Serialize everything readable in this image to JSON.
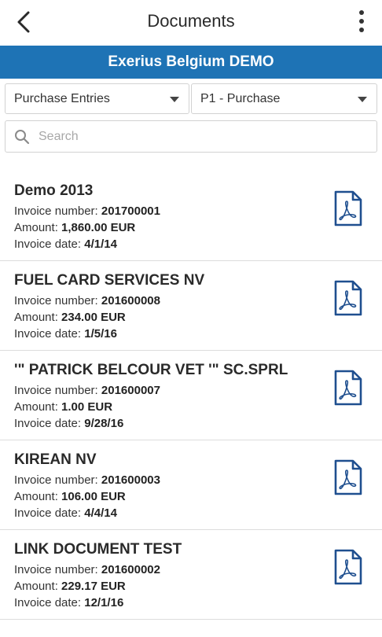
{
  "header": {
    "title": "Documents",
    "back_icon": "chevron-left-icon",
    "menu_icon": "more-vertical-icon"
  },
  "company": {
    "name": "Exerius Belgium DEMO",
    "color": "#1e73b5"
  },
  "filters": {
    "journal_type": "Purchase Entries",
    "journal": "P1 - Purchase"
  },
  "search": {
    "placeholder": "Search",
    "value": ""
  },
  "labels": {
    "invoice_number": "Invoice number: ",
    "amount": "Amount: ",
    "invoice_date": "Invoice date: "
  },
  "documents": [
    {
      "title": "Demo 2013",
      "invoice_number": "201700001",
      "amount": "1,860.00 EUR",
      "invoice_date": "4/1/14",
      "icon": "pdf-icon"
    },
    {
      "title": "FUEL CARD SERVICES NV",
      "invoice_number": "201600008",
      "amount": "234.00 EUR",
      "invoice_date": "1/5/16",
      "icon": "pdf-icon"
    },
    {
      "title": "'\" PATRICK BELCOUR VET '\" SC.SPRL",
      "invoice_number": "201600007",
      "amount": "1.00 EUR",
      "invoice_date": "9/28/16",
      "icon": "pdf-icon"
    },
    {
      "title": "KIREAN NV",
      "invoice_number": "201600003",
      "amount": "106.00 EUR",
      "invoice_date": "4/4/14",
      "icon": "pdf-icon"
    },
    {
      "title": "LINK DOCUMENT TEST",
      "invoice_number": "201600002",
      "amount": "229.17 EUR",
      "invoice_date": "12/1/16",
      "icon": "pdf-icon"
    }
  ]
}
